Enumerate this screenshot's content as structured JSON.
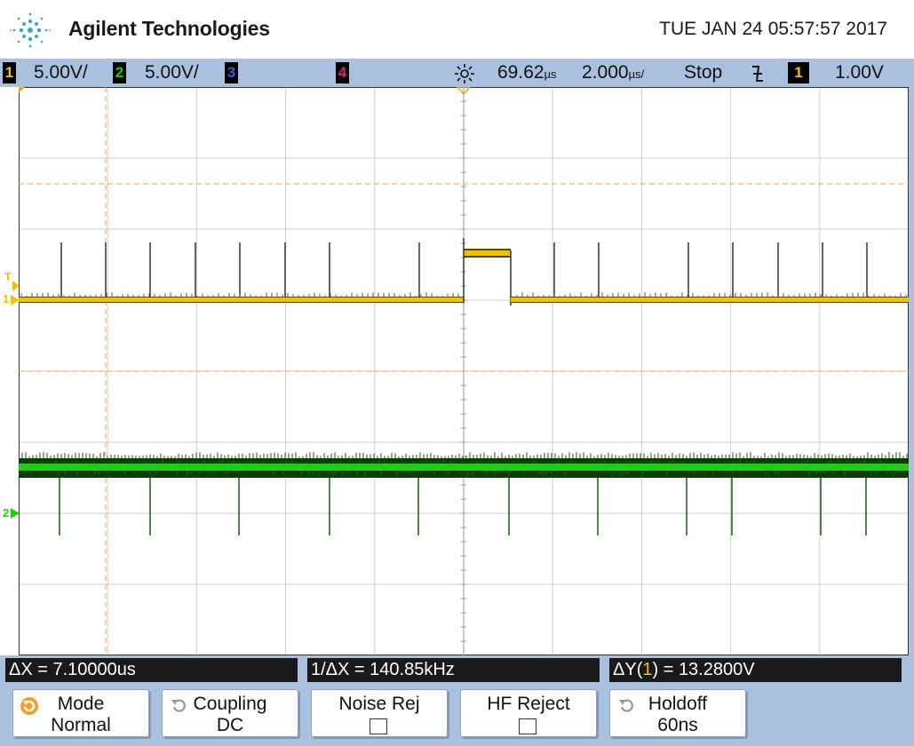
{
  "header": {
    "brand": "Agilent Technologies",
    "datetime": "TUE JAN 24 05:57:57 2017"
  },
  "status": {
    "ch1_num": "1",
    "ch1_scale": "5.00V/",
    "ch2_num": "2",
    "ch2_scale": "5.00V/",
    "ch3_num": "3",
    "ch4_num": "4",
    "trigger_delay": "69.62",
    "trigger_delay_unit": "µs",
    "timebase": "2.000",
    "timebase_unit": "µs/",
    "run_state": "Stop",
    "trigger_edge": "falling-edge",
    "trigger_source": "1",
    "trigger_level": "1.00V"
  },
  "markers": {
    "trigger_marker": "T",
    "ch1_ground": "1",
    "ch2_ground": "2"
  },
  "readouts": {
    "dx": "ΔX = 7.10000us",
    "inv_dx": "1/ΔX = 140.85kHz",
    "dy_prefix": "ΔY(",
    "dy_channel": "1",
    "dy_suffix": ") = 13.2800V"
  },
  "softkeys": [
    {
      "line1": "Mode",
      "line2": "Normal",
      "icon": "rotary-knob-active"
    },
    {
      "line1": "Coupling",
      "line2": "DC",
      "icon": "rotary-knob"
    },
    {
      "line1": "Noise Rej",
      "line2": "",
      "icon": "checkbox"
    },
    {
      "line1": "HF Reject",
      "line2": "",
      "icon": "checkbox"
    },
    {
      "line1": "Holdoff",
      "line2": "60ns",
      "icon": "rotary-knob"
    }
  ],
  "colors": {
    "ch1": "#f2c000",
    "ch2": "#22cc11",
    "ch3": "#3a5fd0",
    "ch4": "#e0207a",
    "cursor": "#f0a030",
    "grid": "#cfcfcf",
    "bar_bg": "#a9c0de"
  }
}
